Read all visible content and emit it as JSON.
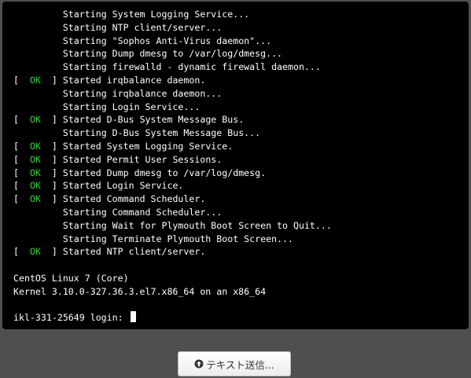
{
  "console": {
    "lines": [
      {
        "pre": "         ",
        "status": "",
        "post": "",
        "text": "Starting System Logging Service..."
      },
      {
        "pre": "         ",
        "status": "",
        "post": "",
        "text": "Starting NTP client/server..."
      },
      {
        "pre": "         ",
        "status": "",
        "post": "",
        "text": "Starting \"Sophos Anti-Virus daemon\"..."
      },
      {
        "pre": "         ",
        "status": "",
        "post": "",
        "text": "Starting Dump dmesg to /var/log/dmesg..."
      },
      {
        "pre": "         ",
        "status": "",
        "post": "",
        "text": "Starting firewalld - dynamic firewall daemon..."
      },
      {
        "pre": "[  ",
        "status": "OK",
        "post": "  ] ",
        "text": "Started irqbalance daemon."
      },
      {
        "pre": "         ",
        "status": "",
        "post": "",
        "text": "Starting irqbalance daemon..."
      },
      {
        "pre": "         ",
        "status": "",
        "post": "",
        "text": "Starting Login Service..."
      },
      {
        "pre": "[  ",
        "status": "OK",
        "post": "  ] ",
        "text": "Started D-Bus System Message Bus."
      },
      {
        "pre": "         ",
        "status": "",
        "post": "",
        "text": "Starting D-Bus System Message Bus..."
      },
      {
        "pre": "[  ",
        "status": "OK",
        "post": "  ] ",
        "text": "Started System Logging Service."
      },
      {
        "pre": "[  ",
        "status": "OK",
        "post": "  ] ",
        "text": "Started Permit User Sessions."
      },
      {
        "pre": "[  ",
        "status": "OK",
        "post": "  ] ",
        "text": "Started Dump dmesg to /var/log/dmesg."
      },
      {
        "pre": "[  ",
        "status": "OK",
        "post": "  ] ",
        "text": "Started Login Service."
      },
      {
        "pre": "[  ",
        "status": "OK",
        "post": "  ] ",
        "text": "Started Command Scheduler."
      },
      {
        "pre": "         ",
        "status": "",
        "post": "",
        "text": "Starting Command Scheduler..."
      },
      {
        "pre": "         ",
        "status": "",
        "post": "",
        "text": "Starting Wait for Plymouth Boot Screen to Quit..."
      },
      {
        "pre": "         ",
        "status": "",
        "post": "",
        "text": "Starting Terminate Plymouth Boot Screen..."
      },
      {
        "pre": "[  ",
        "status": "OK",
        "post": "  ] ",
        "text": "Started NTP client/server."
      },
      {
        "pre": "",
        "status": "",
        "post": "",
        "text": ""
      },
      {
        "pre": "",
        "status": "",
        "post": "",
        "text": "CentOS Linux 7 (Core)"
      },
      {
        "pre": "",
        "status": "",
        "post": "",
        "text": "Kernel 3.10.0-327.36.3.el7.x86_64 on an x86_64"
      },
      {
        "pre": "",
        "status": "",
        "post": "",
        "text": ""
      }
    ],
    "prompt": "ikl-331-25649 login: "
  },
  "colors": {
    "ok_status": "#3cd13c",
    "terminal_bg": "#000000",
    "page_bg": "#4f4f4f"
  },
  "toolbar": {
    "send_text_label": "テキスト送信...",
    "send_icon": "upload-circle-icon"
  }
}
